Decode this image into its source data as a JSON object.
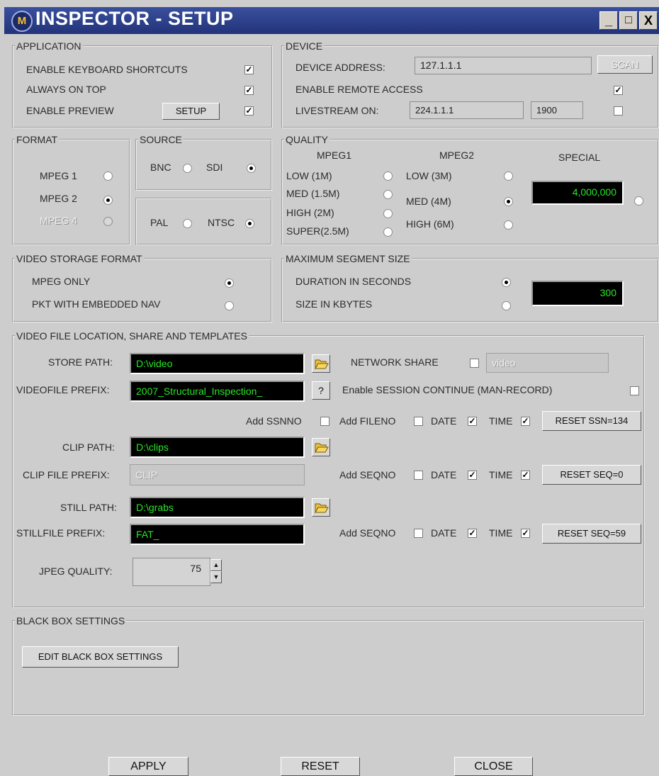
{
  "window": {
    "logo": "M",
    "title": "INSPECTOR - SETUP",
    "minimize": "_",
    "maximize": "□",
    "close": "X"
  },
  "application": {
    "legend": "APPLICATION",
    "enable_keyboard_shortcuts": {
      "label": "ENABLE KEYBOARD SHORTCUTS",
      "checked": true
    },
    "always_on_top": {
      "label": "ALWAYS ON TOP",
      "checked": true
    },
    "enable_preview": {
      "label": "ENABLE PREVIEW",
      "checked": true
    },
    "setup_button": "SETUP"
  },
  "device": {
    "legend": "DEVICE",
    "address_label": "DEVICE ADDRESS:",
    "address_value": "127.1.1.1",
    "scan_button": "SCAN",
    "remote_access": {
      "label": "ENABLE REMOTE ACCESS",
      "checked": true
    },
    "livestream_label": "LIVESTREAM ON:",
    "livestream_ip": "224.1.1.1",
    "livestream_port": "1900",
    "livestream_checked": false
  },
  "format": {
    "legend": "FORMAT",
    "options": [
      {
        "label": "MPEG 1",
        "selected": false,
        "enabled": true
      },
      {
        "label": "MPEG 2",
        "selected": true,
        "enabled": true
      },
      {
        "label": "MPEG 4",
        "selected": false,
        "enabled": false
      }
    ]
  },
  "source": {
    "legend": "SOURCE",
    "input": [
      {
        "label": "BNC",
        "selected": false
      },
      {
        "label": "SDI",
        "selected": true
      }
    ],
    "standard": [
      {
        "label": "PAL",
        "selected": false
      },
      {
        "label": "NTSC",
        "selected": true
      }
    ]
  },
  "quality": {
    "legend": "QUALITY",
    "mpeg1_header": "MPEG1",
    "mpeg2_header": "MPEG2",
    "special_header": "SPECIAL",
    "mpeg1": [
      {
        "label": "LOW (1M)",
        "selected": false
      },
      {
        "label": "MED (1.5M)",
        "selected": false
      },
      {
        "label": "HIGH (2M)",
        "selected": false
      },
      {
        "label": "SUPER(2.5M)",
        "selected": false
      }
    ],
    "mpeg2": [
      {
        "label": "LOW (3M)",
        "selected": false
      },
      {
        "label": "MED (4M)",
        "selected": true
      },
      {
        "label": "HIGH (6M)",
        "selected": false
      }
    ],
    "special_value": "4,000,000",
    "special_selected": false
  },
  "video_storage": {
    "legend": "VIDEO STORAGE FORMAT",
    "mpeg_only": {
      "label": "MPEG ONLY",
      "selected": true
    },
    "pkt_nav": {
      "label": "PKT WITH EMBEDDED NAV",
      "selected": false
    }
  },
  "max_segment": {
    "legend": "MAXIMUM SEGMENT SIZE",
    "duration": {
      "label": "DURATION IN SECONDS",
      "selected": true
    },
    "size": {
      "label": "SIZE IN KBYTES",
      "selected": false
    },
    "value": "300"
  },
  "file_location": {
    "legend": "VIDEO FILE LOCATION, SHARE AND TEMPLATES",
    "store_path_label": "STORE PATH:",
    "store_path": "D:\\video",
    "network_share_label": "NETWORK SHARE",
    "network_share_checked": false,
    "network_share_value": "video",
    "videofile_prefix_label": "VIDEOFILE PREFIX:",
    "videofile_prefix": "2007_Structural_Inspection_",
    "help_button": "?",
    "session_continue_label": "Enable SESSION CONTINUE (MAN-RECORD)",
    "session_continue_checked": false,
    "add_ssnno_label": "Add SSNNO",
    "add_ssnno_checked": false,
    "add_fileno_label": "Add FILENO",
    "add_fileno_checked": false,
    "video_date_label": "DATE",
    "video_date_checked": true,
    "video_time_label": "TIME",
    "video_time_checked": true,
    "reset_ssn_button": "RESET SSN=134",
    "clip_path_label": "CLIP PATH:",
    "clip_path": "D:\\clips",
    "clip_prefix_label": "CLIP FILE PREFIX:",
    "clip_prefix": "CLIP",
    "clip_seqno_label": "Add SEQNO",
    "clip_seqno_checked": false,
    "clip_date_label": "DATE",
    "clip_date_checked": true,
    "clip_time_label": "TIME",
    "clip_time_checked": true,
    "clip_reset_button": "RESET SEQ=0",
    "still_path_label": "STILL PATH:",
    "still_path": "D:\\grabs",
    "still_prefix_label": "STILLFILE PREFIX:",
    "still_prefix": "FAT_",
    "still_seqno_label": "Add SEQNO",
    "still_seqno_checked": false,
    "still_date_label": "DATE",
    "still_date_checked": true,
    "still_time_label": "TIME",
    "still_time_checked": true,
    "still_reset_button": "RESET SEQ=59",
    "jpeg_quality_label": "JPEG QUALITY:",
    "jpeg_quality": "75"
  },
  "black_box": {
    "legend": "BLACK BOX SETTINGS",
    "edit_button": "EDIT BLACK BOX SETTINGS"
  },
  "footer": {
    "apply": "APPLY",
    "reset": "RESET",
    "close": "CLOSE"
  }
}
